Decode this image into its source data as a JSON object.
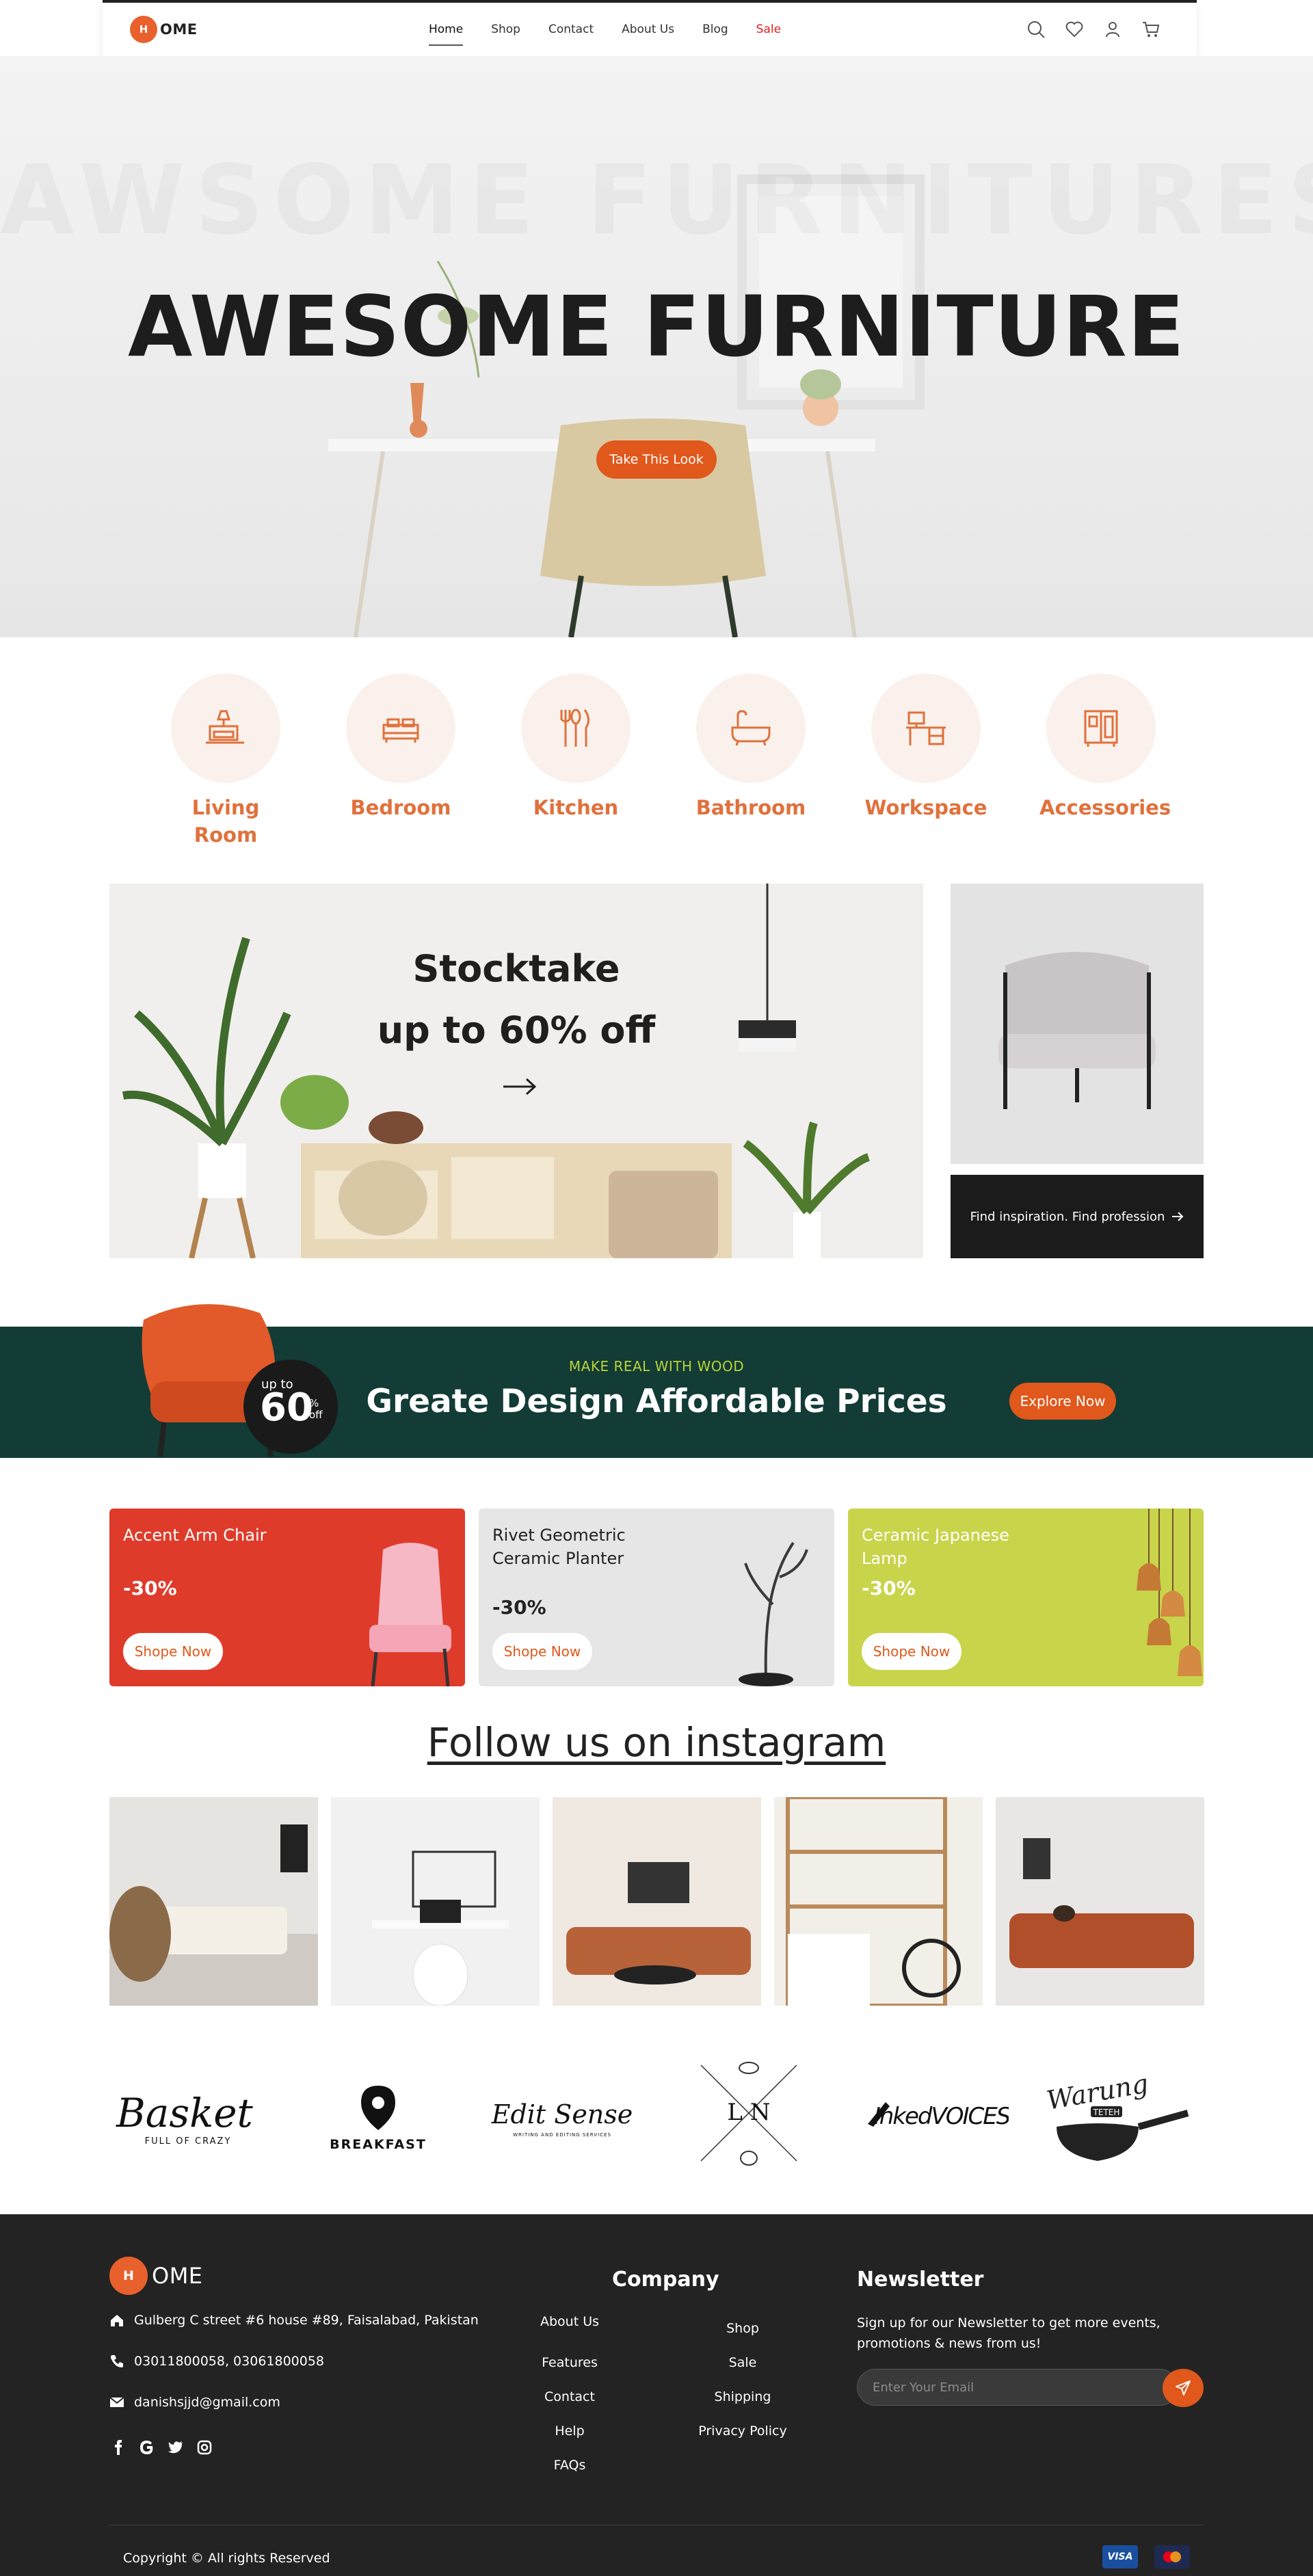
{
  "brand": {
    "logo_mark": "H",
    "logo_text": "OME",
    "accent": "#e0581b"
  },
  "nav": {
    "links": [
      "Home",
      "Shop",
      "Contact",
      "About Us",
      "Blog",
      "Sale"
    ],
    "active": "Home",
    "icons": [
      "search-icon",
      "heart-icon",
      "user-icon",
      "cart-icon"
    ]
  },
  "hero": {
    "watermark": "AWSOME FURNITURES",
    "title": "AWESOME FURNITURE",
    "button": "Take This Look"
  },
  "categories": [
    {
      "label": "Living Room",
      "icon": "living-room-icon"
    },
    {
      "label": "Bedroom",
      "icon": "bed-icon"
    },
    {
      "label": "Kitchen",
      "icon": "kitchen-utensils-icon"
    },
    {
      "label": "Bathroom",
      "icon": "bathtub-icon"
    },
    {
      "label": "Workspace",
      "icon": "desk-icon"
    },
    {
      "label": "Accessories",
      "icon": "cabinet-icon"
    }
  ],
  "stocktake": {
    "line1": "Stocktake",
    "line2": "up to 60% off"
  },
  "side_cta": {
    "label": "Find inspiration. Find profession"
  },
  "wood_banner": {
    "kicker": "MAKE REAL WITH WOOD",
    "title": "Greate Design Affordable Prices",
    "button": "Explore Now",
    "badge_up": "up to",
    "badge_value": "60",
    "badge_pct": "%",
    "badge_off": "off",
    "bg": "#123c35"
  },
  "product_cards": [
    {
      "name": "Accent Arm Chair",
      "discount": "-30%",
      "button": "Shope Now",
      "bg": "#df3b2b"
    },
    {
      "name": "Rivet Geometric Ceramic Planter",
      "discount": "-30%",
      "button": "Shope Now",
      "bg": "#e6e6e6"
    },
    {
      "name": "Ceramic Japanese Lamp",
      "discount": "-30%",
      "button": "Shope Now",
      "bg": "#c8d44a"
    }
  ],
  "instagram": {
    "title": "Follow us on instagram"
  },
  "brands": [
    {
      "name": "Basket",
      "tagline": "FULL OF CRAZY"
    },
    {
      "name": "BREAKFAST"
    },
    {
      "name": "Edit Sense",
      "tagline": "WRITING AND EDITING SERVICES"
    },
    {
      "name": "L N"
    },
    {
      "name": "InkedVOICES"
    },
    {
      "name": "Warung",
      "tagline": "TETEH"
    }
  ],
  "footer": {
    "logo_text": "OME",
    "address": "Gulberg C street #6 house #89, Faisalabad, Pakistan",
    "phone": "03011800058, 03061800058",
    "email": "danishsjjd@gmail.com",
    "socials": [
      "facebook-icon",
      "google-icon",
      "twitter-icon",
      "instagram-icon"
    ],
    "company_heading": "Company",
    "company_col1": [
      "About Us",
      "Features",
      "Contact",
      "Help",
      "FAQs"
    ],
    "company_col2": [
      "Shop",
      "Sale",
      "Shipping",
      "Privacy Policy"
    ],
    "newsletter_heading": "Newsletter",
    "newsletter_text": "Sign up for our Newsletter to get more events, promotions & news from us!",
    "email_placeholder": "Enter Your Email",
    "copyright": "Copyright © All rights Reserved",
    "payments": [
      "VISA",
      "mastercard"
    ]
  }
}
